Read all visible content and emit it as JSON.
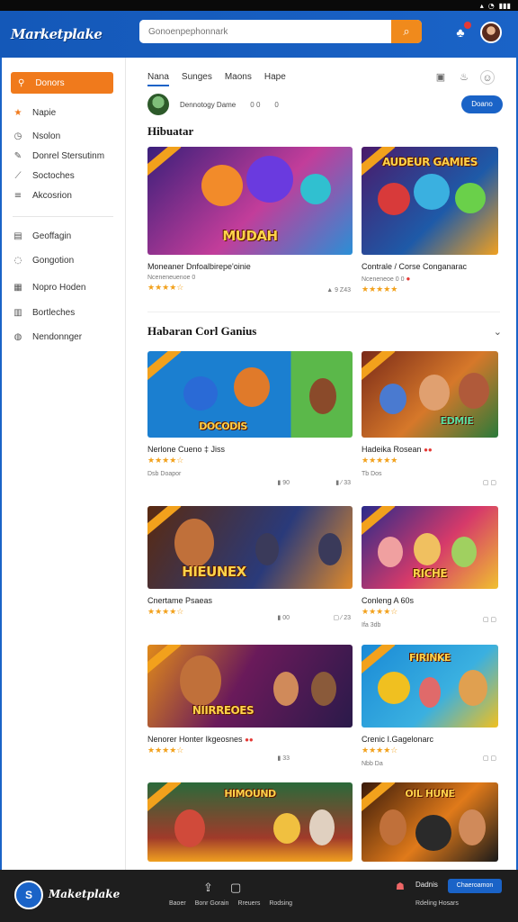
{
  "status_bar": {
    "icons": [
      "signal-icon",
      "wifi-icon",
      "battery-icon"
    ],
    "text": "▮▮▮"
  },
  "header": {
    "logo": "Marketplake",
    "search_placeholder": "Gonoenpephonnark",
    "accent": "#1a63c7",
    "search_button_color": "#f08a1c"
  },
  "sidebar": {
    "primary_label": "Donors",
    "items": [
      {
        "label": "Napie",
        "icon": "star-icon"
      },
      {
        "label": "Nsolon",
        "icon": "clock-icon"
      },
      {
        "label": "Donrel Stersutinm",
        "icon": "pencil-icon"
      },
      {
        "label": "Soctoches",
        "icon": "link-icon"
      },
      {
        "label": "Akcosrion",
        "icon": "list-icon"
      }
    ],
    "items2": [
      {
        "label": "Geoffagin",
        "icon": "calendar-icon"
      },
      {
        "label": "Gongotion",
        "icon": "chat-icon"
      },
      {
        "label": "Nopro Hoden",
        "icon": "grid-icon"
      },
      {
        "label": "Bortleches",
        "icon": "document-icon"
      },
      {
        "label": "Nendonnger",
        "icon": "gamepad-icon"
      }
    ]
  },
  "main": {
    "tabs": [
      "Nana",
      "Sunges",
      "Maons",
      "Hape"
    ],
    "profile": {
      "name": "Dennotogy Dame",
      "stat1": "0 0",
      "stat2": "0",
      "follow": "Doano"
    },
    "section1_title": "Hibuatar",
    "section2_title": "Habaran Corl Ganius",
    "featured": [
      {
        "art": "MUDAH",
        "title": "Moneaner Dnfoalbirepe'oinie",
        "sub": "Nceneneuenoe 0",
        "stars": "★★★★☆",
        "meta": "▲ 9 Z43",
        "colors": [
          "#3a1f7a",
          "#c23d9a",
          "#2a8fd6"
        ]
      },
      {
        "art": "AUDEUR GAMIES",
        "title": "Contrale / Corse Conganarac",
        "sub": "Nceneneoe 0 0",
        "stars": "★★★★★",
        "meta": "",
        "colors": [
          "#4a1a6a",
          "#1e5aa8",
          "#f0a020"
        ]
      }
    ],
    "grid": [
      {
        "art": "DOCODIS",
        "title": "Nerlone Cueno ‡ Jiss",
        "stars": "★★★★☆",
        "meta_left": "Dsb Doapor",
        "meta_right": "▮ 90",
        "meta_right2": "▮ ⁄ 33",
        "colors": [
          "#1b7fd0",
          "#5bb84a",
          "#e07a2a"
        ]
      },
      {
        "art": "EDMIE",
        "title": "Hadeika Rosean",
        "stars": "★★★★★",
        "meta_left": "Tb Dos",
        "meta_right": "▢ ▢",
        "meta_right2": "",
        "colors": [
          "#7a2a18",
          "#d6782a",
          "#2a7a3a"
        ]
      },
      {
        "art": "HIEUNEX",
        "title": "Cnertame Psaeas",
        "stars": "★★★★☆",
        "meta_left": "",
        "meta_right": "▮ 00",
        "meta_right2": "▢ ⁄ 23",
        "colors": [
          "#5a2a10",
          "#2a3a7a",
          "#e08a2a"
        ]
      },
      {
        "art": "RICHE",
        "title": "Conleng A 60s",
        "stars": "★★★★☆",
        "meta_left": "Ifa 3db",
        "meta_right": "▢ ▢",
        "meta_right2": "",
        "colors": [
          "#2a2a8a",
          "#d63a6a",
          "#f0c030"
        ]
      },
      {
        "art": "NIIRREOES",
        "title": "Nenorer Honter Ikgeosnes",
        "stars": "★★★★☆",
        "meta_left": "",
        "meta_right": "▮ 33",
        "meta_right2": "",
        "colors": [
          "#6a1a5a",
          "#e08a1a",
          "#2a1a4a"
        ]
      },
      {
        "art": "FIRINKE",
        "title": "Crenic I.Gagelonarc",
        "stars": "★★★★☆",
        "meta_left": "Nbb Da",
        "meta_right": "▢ ▢",
        "meta_right2": "",
        "colors": [
          "#1a8ad6",
          "#f0c020",
          "#3ab0e0"
        ]
      },
      {
        "art": "HIMOUND",
        "title": "",
        "stars": "",
        "meta_left": "",
        "meta_right": "",
        "meta_right2": "",
        "colors": [
          "#2a6a3a",
          "#a03a2a",
          "#f0a020"
        ]
      },
      {
        "art": "OIL HUNE",
        "title": "",
        "stars": "",
        "meta_left": "",
        "meta_right": "",
        "meta_right2": "",
        "colors": [
          "#3a1a0a",
          "#e07a1a",
          "#1a1a1a"
        ]
      }
    ]
  },
  "bottom_bar": {
    "logo": "S",
    "name": "Maketplake",
    "labels": [
      "Baoer",
      "Bonr Gorain",
      "Rreuers",
      "Rodsing"
    ],
    "right_label": "Dadnis",
    "right_button": "Chaeroamon",
    "right_sub": "Rdeling Hosars"
  }
}
